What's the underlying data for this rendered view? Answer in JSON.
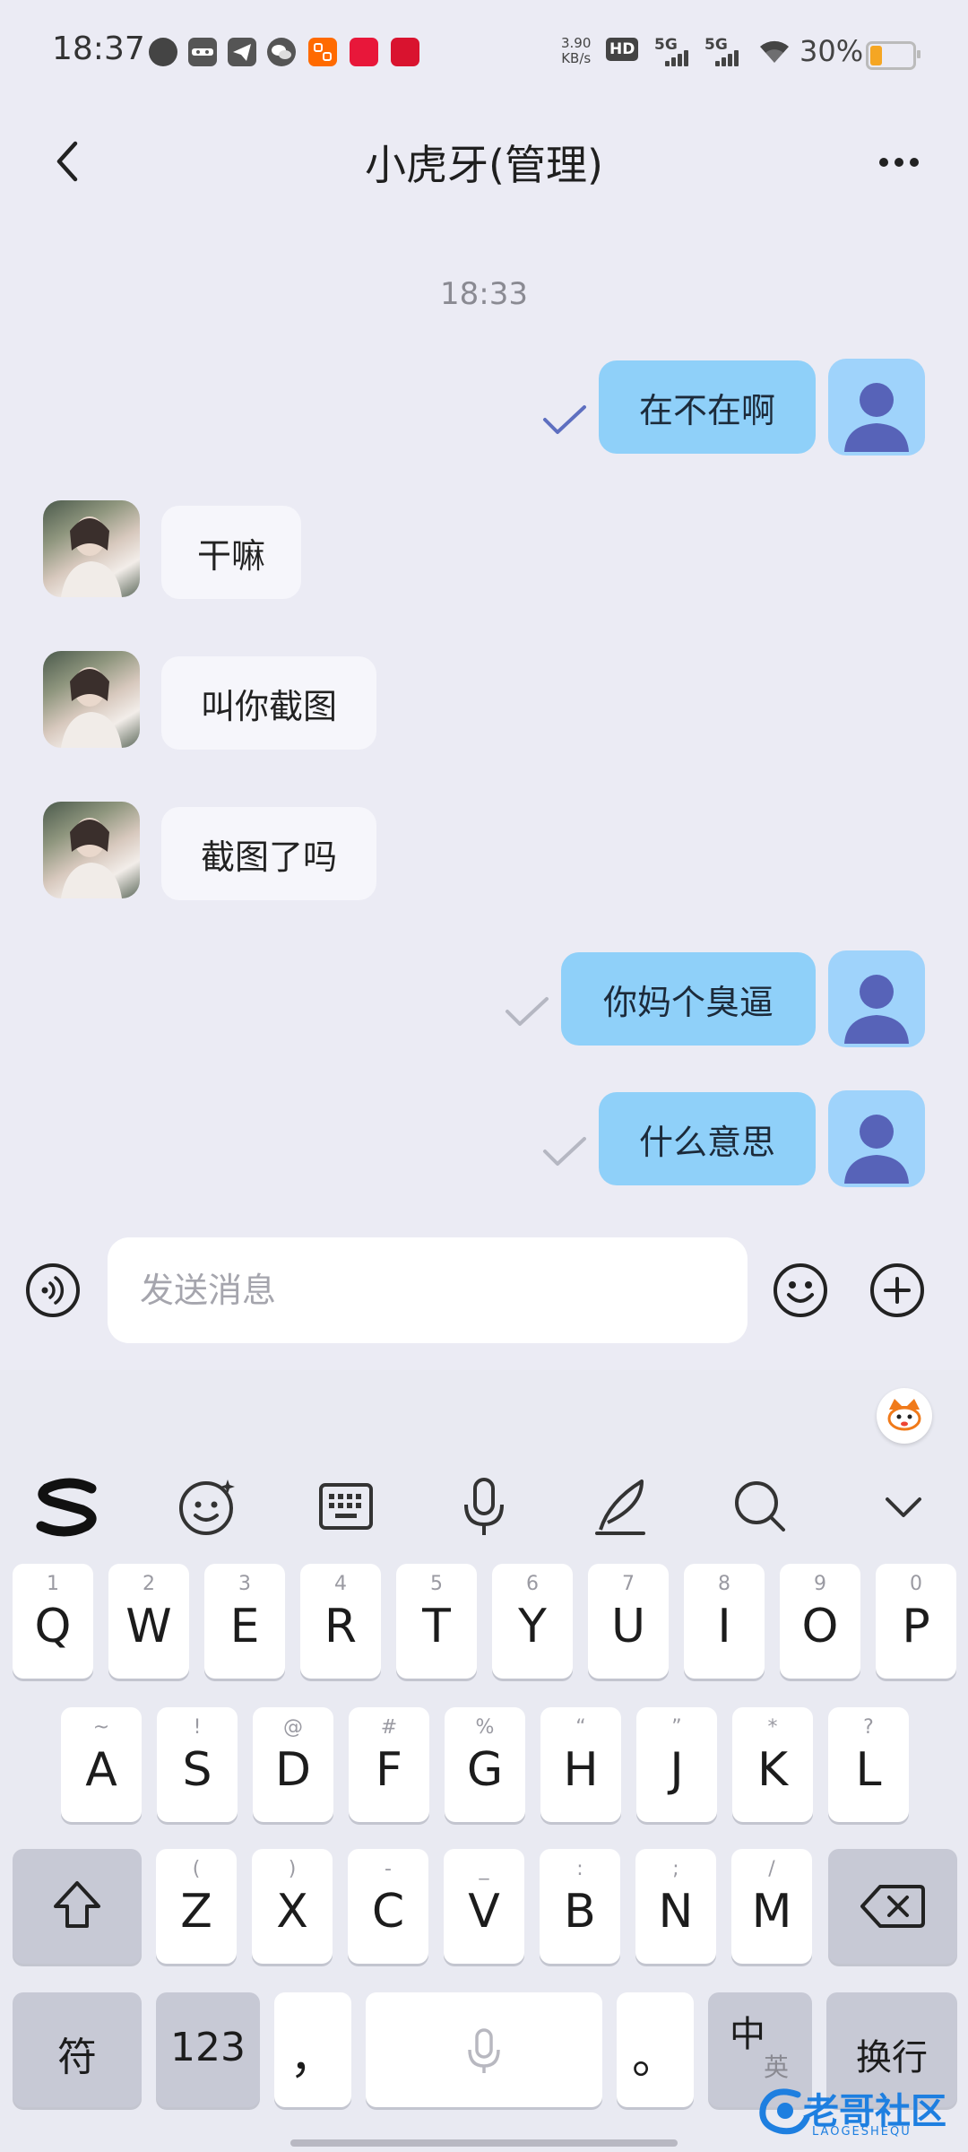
{
  "status_bar": {
    "time": "18:37",
    "net_speed_value": "3.90",
    "net_speed_unit": "KB/s",
    "hd_label": "HD",
    "signal_1": "5G",
    "signal_2": "5G",
    "battery_percent": "30%",
    "battery_level": 0.3,
    "app_icons": [
      "chat-bubble-icon",
      "ninja-icon",
      "telegram-icon",
      "wechat-icon",
      "taobao-icon",
      "xiaohongshu-icon",
      "pinduoduo-icon"
    ]
  },
  "header": {
    "title": "小虎牙(管理)"
  },
  "chat": {
    "time_divider": "18:33",
    "messages": [
      {
        "direction": "out",
        "text": "在不在啊",
        "status": "read"
      },
      {
        "direction": "in",
        "text": "干嘛"
      },
      {
        "direction": "in",
        "text": "叫你截图"
      },
      {
        "direction": "in",
        "text": "截图了吗"
      },
      {
        "direction": "out",
        "text": "你妈个臭逼",
        "status": "sent"
      },
      {
        "direction": "out",
        "text": "什么意思",
        "status": "sent"
      }
    ]
  },
  "composer": {
    "placeholder": "发送消息",
    "value": ""
  },
  "keyboard": {
    "toolbar": [
      "sogou-logo-icon",
      "emoji-icon",
      "keyboard-icon",
      "microphone-icon",
      "handwriting-icon",
      "search-icon",
      "collapse-icon"
    ],
    "row1": [
      {
        "letter": "Q",
        "sub": "1"
      },
      {
        "letter": "W",
        "sub": "2"
      },
      {
        "letter": "E",
        "sub": "3"
      },
      {
        "letter": "R",
        "sub": "4"
      },
      {
        "letter": "T",
        "sub": "5"
      },
      {
        "letter": "Y",
        "sub": "6"
      },
      {
        "letter": "U",
        "sub": "7"
      },
      {
        "letter": "I",
        "sub": "8"
      },
      {
        "letter": "O",
        "sub": "9"
      },
      {
        "letter": "P",
        "sub": "0"
      }
    ],
    "row2": [
      {
        "letter": "A",
        "sub": "~"
      },
      {
        "letter": "S",
        "sub": "!"
      },
      {
        "letter": "D",
        "sub": "@"
      },
      {
        "letter": "F",
        "sub": "#"
      },
      {
        "letter": "G",
        "sub": "%"
      },
      {
        "letter": "H",
        "sub": "“"
      },
      {
        "letter": "J",
        "sub": "”"
      },
      {
        "letter": "K",
        "sub": "*"
      },
      {
        "letter": "L",
        "sub": "?"
      }
    ],
    "row3": [
      {
        "letter": "Z",
        "sub": "("
      },
      {
        "letter": "X",
        "sub": ")"
      },
      {
        "letter": "C",
        "sub": "-"
      },
      {
        "letter": "V",
        "sub": "_"
      },
      {
        "letter": "B",
        "sub": ":"
      },
      {
        "letter": "N",
        "sub": ";"
      },
      {
        "letter": "M",
        "sub": "/"
      }
    ],
    "symbol_key": "符",
    "number_key": "123",
    "comma_key": "，",
    "period_key": "。",
    "lang_key_main": "中",
    "lang_key_sub": "英",
    "enter_key": "换行"
  },
  "watermark": {
    "text": "老哥社区",
    "subtext": "LAOGESHEQU"
  },
  "colors": {
    "background": "#ebebf4",
    "outgoing_bubble": "#8fd0f9",
    "incoming_bubble": "#f6f6fb",
    "read_check": "#5e6fc0",
    "sent_check": "#b5b7c2",
    "avatar_user_bg": "#9fd3fb",
    "avatar_user_fg": "#5763b8"
  }
}
